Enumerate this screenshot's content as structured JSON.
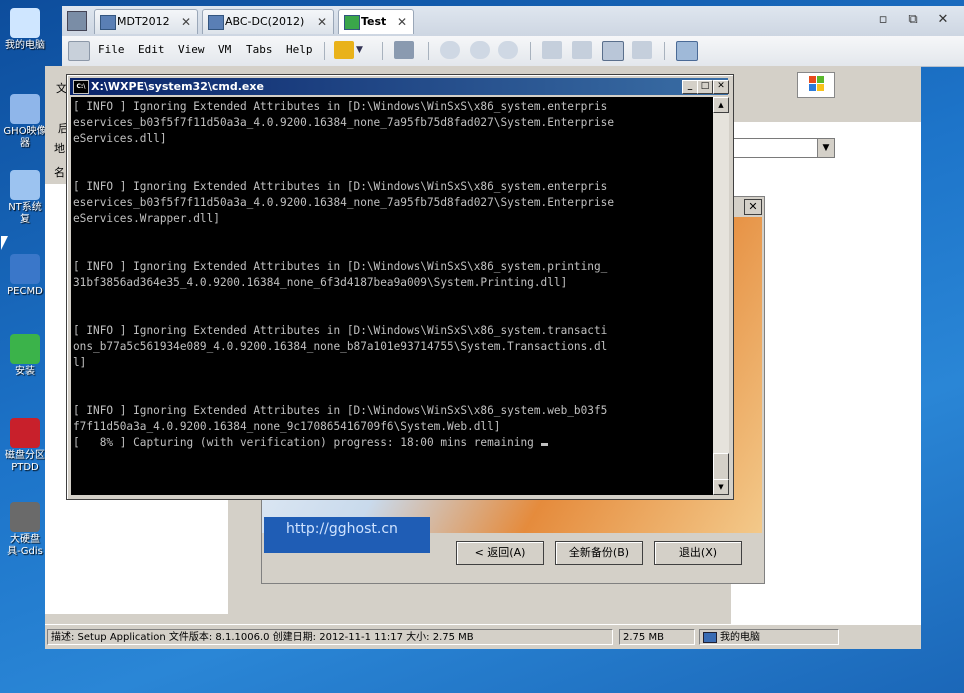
{
  "desktop": {
    "icons": [
      {
        "label": "我的电脑",
        "color": "#cfe6ff"
      },
      {
        "label": "GHO映像\n器",
        "color": "#8fb6ea"
      },
      {
        "label": "NT系统\n复",
        "color": "#9cc3f0"
      },
      {
        "label": "PECMD",
        "color": "#3a77c9"
      },
      {
        "label": "安装",
        "color": "#3bb34a"
      },
      {
        "label": "磁盘分区\nPTDD",
        "color": "#c8202b"
      },
      {
        "label": "大硬盘\n具-Gdis",
        "color": "#6a6a6a"
      }
    ]
  },
  "vmware": {
    "tabs": [
      {
        "label": "MDT2012",
        "active": false
      },
      {
        "label": "ABC-DC(2012)",
        "active": false
      },
      {
        "label": "Test",
        "active": true
      }
    ],
    "tab_close": "✕",
    "window_controls": [
      "▫",
      "⧉",
      "✕"
    ],
    "menu": [
      "File",
      "Edit",
      "View",
      "VM",
      "Tabs",
      "Help"
    ]
  },
  "cmd": {
    "title": "X:\\WXPE\\system32\\cmd.exe",
    "lines": [
      "[ INFO ] Ignoring Extended Attributes in [D:\\Windows\\WinSxS\\x86_system.enterpris",
      "eservices_b03f5f7f11d50a3a_4.0.9200.16384_none_7a95fb75d8fad027\\System.Enterprise",
      "eServices.dll]",
      "",
      "",
      "[ INFO ] Ignoring Extended Attributes in [D:\\Windows\\WinSxS\\x86_system.enterpris",
      "eservices_b03f5f7f11d50a3a_4.0.9200.16384_none_7a95fb75d8fad027\\System.Enterprise",
      "eServices.Wrapper.dll]",
      "",
      "",
      "[ INFO ] Ignoring Extended Attributes in [D:\\Windows\\WinSxS\\x86_system.printing_",
      "31bf3856ad364e35_4.0.9200.16384_none_6f3d4187bea9a009\\System.Printing.dll]",
      "",
      "",
      "[ INFO ] Ignoring Extended Attributes in [D:\\Windows\\WinSxS\\x86_system.transacti",
      "ons_b77a5c561934e089_4.0.9200.16384_none_b87a101e93714755\\System.Transactions.dl",
      "l]",
      "",
      "",
      "[ INFO ] Ignoring Extended Attributes in [D:\\Windows\\WinSxS\\x86_system.web_b03f5",
      "f7f11d50a3a_4.0.9200.16384_none_9c170865416709f6\\System.Web.dll]",
      "[   8% ] Capturing (with verification) progress: 18:00 mins remaining "
    ]
  },
  "background_dialog": {
    "url_text": "http://gghost.cn",
    "buttons": [
      "< 返回(A)",
      "全新备份(B)",
      "退出(X)"
    ],
    "close": "✕"
  },
  "explorer": {
    "left_labels": [
      "文",
      "后",
      "地",
      "名"
    ]
  },
  "statusbar": {
    "description": "描述: Setup Application 文件版本: 8.1.1006.0 创建日期: 2012-11-1 11:17 大小: 2.75 MB",
    "size": "2.75 MB",
    "location": "我的电脑"
  }
}
